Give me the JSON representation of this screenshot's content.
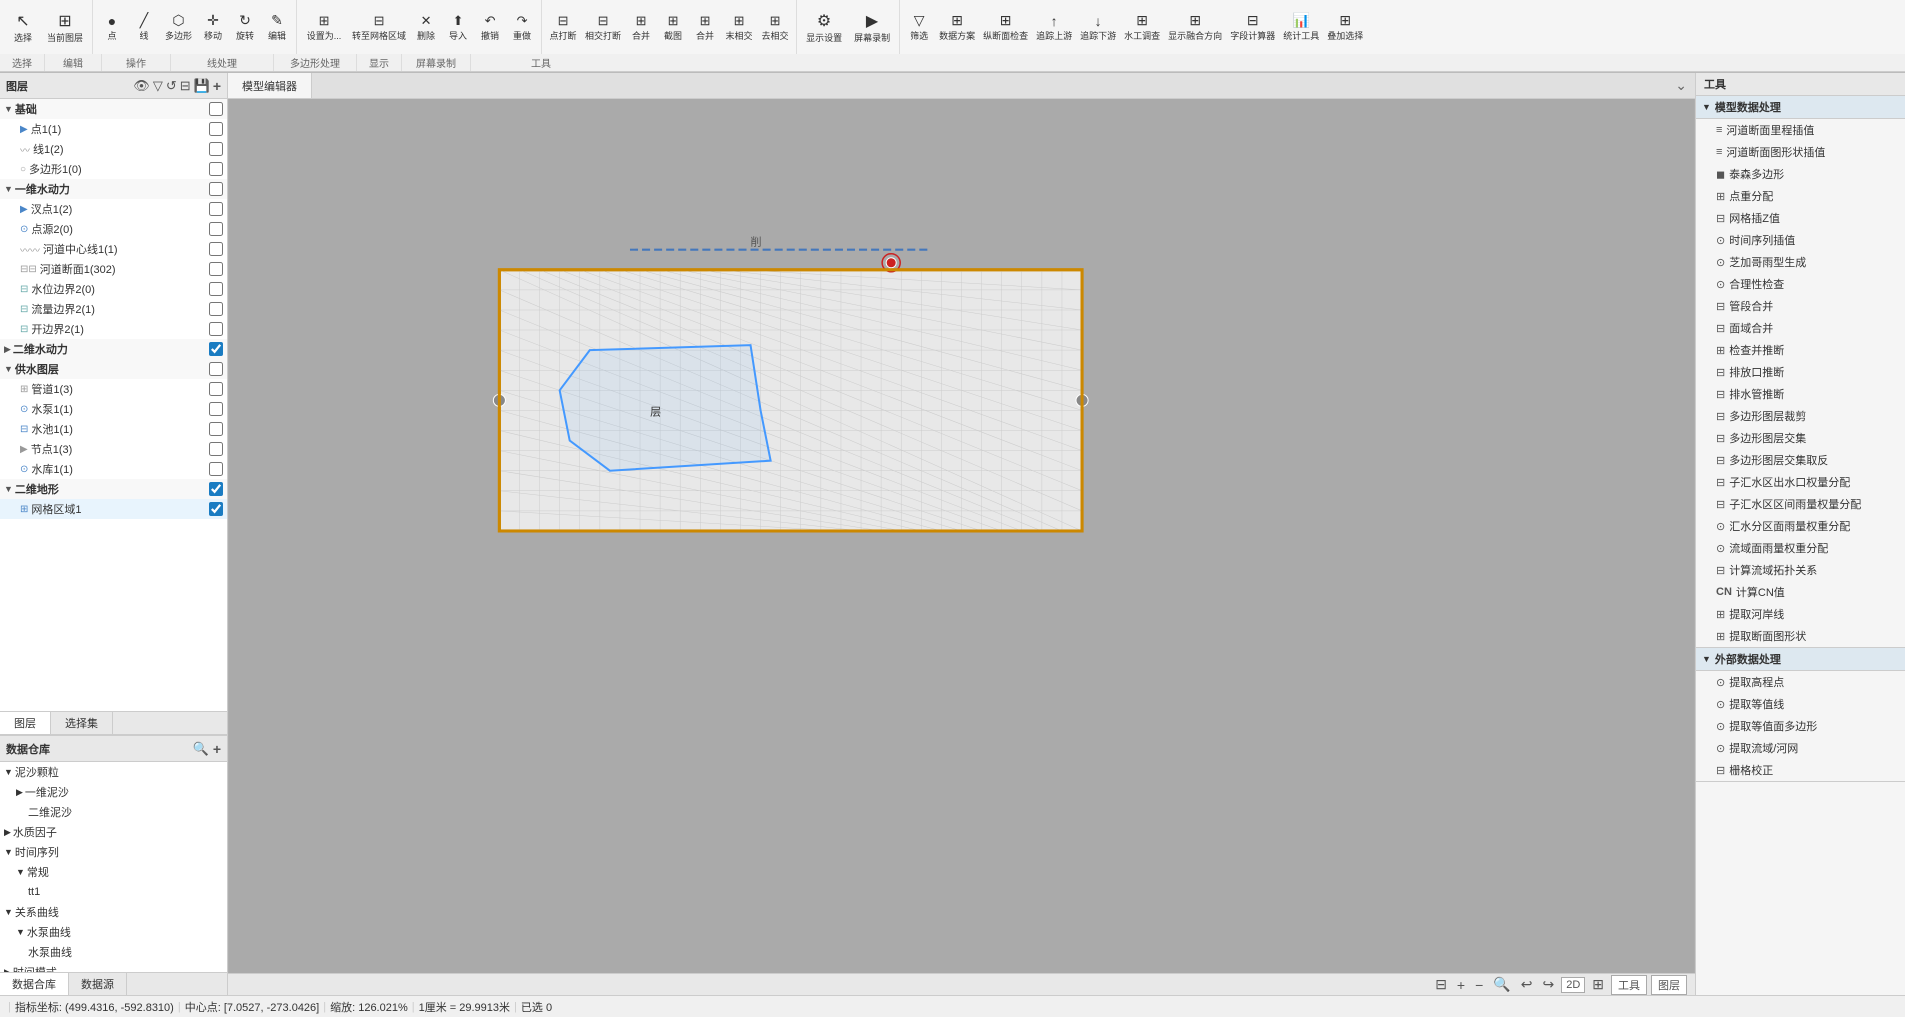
{
  "toolbar": {
    "groups": [
      {
        "label": "选择",
        "items": [
          {
            "id": "select",
            "icon": "↖",
            "label": "选择"
          },
          {
            "id": "current-layer",
            "icon": "⊞",
            "label": "当前图层"
          }
        ]
      },
      {
        "label": "编辑",
        "items": [
          {
            "id": "point",
            "icon": "●",
            "label": "点"
          },
          {
            "id": "line",
            "icon": "╱",
            "label": "线"
          },
          {
            "id": "polygon",
            "icon": "⬡",
            "label": "多边形"
          },
          {
            "id": "move",
            "icon": "✛",
            "label": "移动"
          },
          {
            "id": "rotate",
            "icon": "↻",
            "label": "旋转"
          },
          {
            "id": "edit",
            "icon": "✎",
            "label": "编辑"
          }
        ]
      },
      {
        "label": "操作",
        "items": [
          {
            "id": "set-value",
            "icon": "⊞",
            "label": "设置为..."
          },
          {
            "id": "to-mesh-area",
            "icon": "⊟",
            "label": "转至网格区域"
          },
          {
            "id": "delete",
            "icon": "✕",
            "label": "删除"
          },
          {
            "id": "import",
            "icon": "⬆",
            "label": "导入"
          },
          {
            "id": "undo",
            "icon": "↶",
            "label": "撤销"
          },
          {
            "id": "redo",
            "icon": "↷",
            "label": "重做"
          }
        ]
      },
      {
        "label": "线处理",
        "items": [
          {
            "id": "open-edit",
            "icon": "⊞",
            "label": "点打断"
          },
          {
            "id": "adjacent-open",
            "icon": "⊟",
            "label": "相交打断"
          },
          {
            "id": "merge",
            "icon": "⊞",
            "label": "合并"
          },
          {
            "id": "screen-capture",
            "icon": "⊞",
            "label": "截图"
          },
          {
            "id": "merge2",
            "icon": "⊞",
            "label": "合并"
          },
          {
            "id": "join",
            "icon": "⊞",
            "label": "末相交"
          },
          {
            "id": "control",
            "icon": "⊞",
            "label": "去相交"
          }
        ]
      },
      {
        "label": "多边形处理",
        "items": [
          {
            "id": "display-settings",
            "icon": "⚙",
            "label": "显示设置"
          },
          {
            "id": "screen-record",
            "icon": "▶",
            "label": "屏幕录制"
          }
        ]
      },
      {
        "label": "显示",
        "items": []
      },
      {
        "label": "屏幕录制",
        "items": []
      },
      {
        "label": "工具",
        "items": [
          {
            "id": "filter",
            "icon": "▽",
            "label": "筛选"
          },
          {
            "id": "data-plan",
            "icon": "⊞",
            "label": "数据方案"
          },
          {
            "id": "longitudinal-check",
            "icon": "⊞",
            "label": "纵断面检查"
          },
          {
            "id": "trace-up",
            "icon": "⊞",
            "label": "追踪上游"
          },
          {
            "id": "trace-down",
            "icon": "⊞",
            "label": "追踪下游"
          },
          {
            "id": "water-conservancy",
            "icon": "⊞",
            "label": "水工调查"
          },
          {
            "id": "display-merge",
            "icon": "⊞",
            "label": "显示融合方向"
          },
          {
            "id": "calc",
            "icon": "⊞",
            "label": "字段计算器"
          },
          {
            "id": "stats",
            "icon": "⊞",
            "label": "统计工具"
          },
          {
            "id": "add-select",
            "icon": "⊞",
            "label": "叠加选择"
          }
        ]
      }
    ]
  },
  "left_panel": {
    "title": "图层",
    "tabs": [
      "图层",
      "选择集"
    ],
    "layers": [
      {
        "id": "basic",
        "name": "基础",
        "level": 0,
        "type": "group",
        "expanded": true,
        "checked": false
      },
      {
        "id": "point1",
        "name": "点1(1)",
        "level": 1,
        "type": "point",
        "checked": false
      },
      {
        "id": "line1",
        "name": "线1(2)",
        "level": 1,
        "type": "line",
        "checked": false
      },
      {
        "id": "polygon0",
        "name": "多边形1(0)",
        "level": 1,
        "type": "polygon",
        "checked": false
      },
      {
        "id": "1d-hydro",
        "name": "一维水动力",
        "level": 0,
        "type": "group",
        "expanded": true,
        "checked": false
      },
      {
        "id": "flood1",
        "name": "汊点1(2)",
        "level": 1,
        "type": "point",
        "checked": false
      },
      {
        "id": "source2",
        "name": "点源2(0)",
        "level": 1,
        "type": "point",
        "checked": false
      },
      {
        "id": "river-center",
        "name": "河道中心线1(1)",
        "level": 1,
        "type": "line",
        "checked": false
      },
      {
        "id": "river-cross",
        "name": "河道断面1(302)",
        "level": 1,
        "type": "cross",
        "checked": false
      },
      {
        "id": "water-boundary",
        "name": "水位边界2(0)",
        "level": 1,
        "type": "boundary",
        "checked": false
      },
      {
        "id": "flow-boundary",
        "name": "流量边界2(1)",
        "level": 1,
        "type": "boundary",
        "checked": false
      },
      {
        "id": "open-boundary",
        "name": "开边界2(1)",
        "level": 1,
        "type": "boundary",
        "checked": false
      },
      {
        "id": "2d-hydro",
        "name": "二维水动力",
        "level": 0,
        "type": "group",
        "expanded": false,
        "checked": true
      },
      {
        "id": "water-supply",
        "name": "供水图层",
        "level": 0,
        "type": "group",
        "expanded": true,
        "checked": false
      },
      {
        "id": "pipe1",
        "name": "管道1(3)",
        "level": 1,
        "type": "pipe",
        "checked": false
      },
      {
        "id": "pump1",
        "name": "水泵1(1)",
        "level": 1,
        "type": "pump",
        "checked": false
      },
      {
        "id": "tank1",
        "name": "水池1(1)",
        "level": 1,
        "type": "tank",
        "checked": false
      },
      {
        "id": "node1",
        "name": "节点1(3)",
        "level": 1,
        "type": "node",
        "checked": false
      },
      {
        "id": "reservoir1",
        "name": "水库1(1)",
        "level": 1,
        "type": "reservoir",
        "checked": false
      },
      {
        "id": "2d-terrain",
        "name": "二维地形",
        "level": 0,
        "type": "group",
        "expanded": true,
        "checked": true
      },
      {
        "id": "mesh-area1",
        "name": "网格区域1",
        "level": 1,
        "type": "mesh",
        "checked": true
      }
    ]
  },
  "db_panel": {
    "title": "数据仓库",
    "items": [
      {
        "id": "sediment",
        "name": "泥沙颗粒",
        "level": 0,
        "type": "group",
        "expanded": true
      },
      {
        "id": "1d-sediment",
        "name": "一维泥沙",
        "level": 1,
        "type": "group",
        "expanded": false
      },
      {
        "id": "2d-sediment",
        "name": "二维泥沙",
        "level": 1,
        "type": "item"
      },
      {
        "id": "water-quality",
        "name": "水质因子",
        "level": 0,
        "type": "group",
        "expanded": false
      },
      {
        "id": "time-series",
        "name": "时间序列",
        "level": 0,
        "type": "group",
        "expanded": true
      },
      {
        "id": "regular",
        "name": "常规",
        "level": 1,
        "type": "group",
        "expanded": true
      },
      {
        "id": "tt1",
        "name": "tt1",
        "level": 2,
        "type": "item"
      },
      {
        "id": "relation-curves",
        "name": "关系曲线",
        "level": 0,
        "type": "group",
        "expanded": true
      },
      {
        "id": "pump-curves",
        "name": "水泵曲线",
        "level": 1,
        "type": "group",
        "expanded": true
      },
      {
        "id": "pump-curve",
        "name": "水泵曲线",
        "level": 2,
        "type": "item"
      },
      {
        "id": "time-mode",
        "name": "时间模式",
        "level": 0,
        "type": "group",
        "expanded": false
      }
    ],
    "bottom_tabs": [
      "数据合库",
      "数据源"
    ]
  },
  "editor_tab": {
    "label": "模型编辑器"
  },
  "right_panel": {
    "title": "工具",
    "sections": [
      {
        "id": "model-data-processing",
        "label": "模型数据处理",
        "expanded": true,
        "items": [
          {
            "id": "river-cross-interp",
            "label": "河道断面里程插值",
            "icon": "≡"
          },
          {
            "id": "river-cross-shape",
            "label": "河道断面图形状插值",
            "icon": "≡"
          },
          {
            "id": "sparse-polygon",
            "label": "泰森多边形",
            "icon": "◼"
          },
          {
            "id": "weight-dist",
            "label": "点重分配",
            "icon": "⊞"
          },
          {
            "id": "grid-interp",
            "label": "网格插Z值",
            "icon": "⊟"
          },
          {
            "id": "time-series-interp",
            "label": "时间序列插值",
            "icon": "⊙"
          },
          {
            "id": "geo-hash-gen",
            "label": "芝加哥雨型生成",
            "icon": "⊙"
          },
          {
            "id": "rationality-check",
            "label": "合理性检查",
            "icon": "⊙"
          },
          {
            "id": "pipe-merge",
            "label": "管段合并",
            "icon": "⊟"
          },
          {
            "id": "area-merge",
            "label": "面域合并",
            "icon": "⊟"
          },
          {
            "id": "check-intersect",
            "label": "检查并推断",
            "icon": "⊞"
          },
          {
            "id": "drain-intersect",
            "label": "排放口推断",
            "icon": "⊟"
          },
          {
            "id": "pipe-intersect",
            "label": "排水管推断",
            "icon": "⊟"
          },
          {
            "id": "polygon-clip",
            "label": "多边形图层裁剪",
            "icon": "⊟"
          },
          {
            "id": "polygon-intersect",
            "label": "多边形图层交集",
            "icon": "⊟"
          },
          {
            "id": "polygon-intersect-rev",
            "label": "多边形图层交集取反",
            "icon": "⊟"
          },
          {
            "id": "sub-basin-outlet",
            "label": "子汇水区出水口权量分配",
            "icon": "⊟"
          },
          {
            "id": "sub-basin-interval",
            "label": "子汇水区区间雨量权量分配",
            "icon": "⊟"
          },
          {
            "id": "basin-rain-weight",
            "label": "汇水分区面雨量权重分配",
            "icon": "⊙"
          },
          {
            "id": "basin-rain-weight2",
            "label": "流域面雨量权重分配",
            "icon": "⊙"
          },
          {
            "id": "calc-basin-topo",
            "label": "计算流域拓扑关系",
            "icon": "⊟"
          },
          {
            "id": "calc-cn",
            "label": "CN 计算CN值",
            "icon": "⊞"
          },
          {
            "id": "extract-river",
            "label": "提取河岸线",
            "icon": "⊞"
          },
          {
            "id": "extract-cross-shape",
            "label": "提取断面图形状",
            "icon": "⊞"
          }
        ]
      },
      {
        "id": "external-data-processing",
        "label": "外部数据处理",
        "expanded": true,
        "items": [
          {
            "id": "extract-elevation",
            "label": "提取高程点",
            "icon": "⊙"
          },
          {
            "id": "extract-contour",
            "label": "提取等值线",
            "icon": "⊙"
          },
          {
            "id": "extract-contour-polygon",
            "label": "提取等值面多边形",
            "icon": "⊙"
          },
          {
            "id": "extract-watershed",
            "label": "提取流域/河网",
            "icon": "⊙"
          },
          {
            "id": "grid-correction",
            "label": "栅格校正",
            "icon": "⊟"
          }
        ]
      }
    ]
  },
  "status_bar": {
    "cursor": "指标坐标: (499.4316, -592.8310)",
    "center": "中心点: [7.0527, -273.0426]",
    "zoom": "缩放: 126.021%",
    "scale": "1厘米 = 29.9913米",
    "selected": "已选 0"
  },
  "bottom_toolbar": {
    "icons": [
      "↙",
      "↗",
      "🔍",
      "⊙",
      "↩",
      "↪",
      "2D",
      "⊞",
      "工具",
      "图层"
    ]
  }
}
